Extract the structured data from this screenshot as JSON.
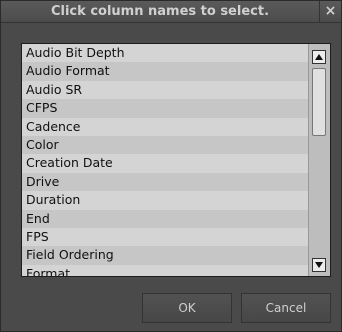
{
  "dialog": {
    "title": "Click column names to select.",
    "close_glyph": "×"
  },
  "columns_list": {
    "items": [
      "Audio Bit Depth",
      "Audio Format",
      "Audio SR",
      "CFPS",
      "Cadence",
      "Color",
      "Creation Date",
      "Drive",
      "Duration",
      "End",
      "FPS",
      "Field Ordering",
      "Format"
    ]
  },
  "buttons": {
    "ok_label": "OK",
    "cancel_label": "Cancel"
  },
  "icons": {
    "close": "close-icon",
    "scroll_up": "arrow-up-icon",
    "scroll_down": "arrow-down-icon"
  }
}
